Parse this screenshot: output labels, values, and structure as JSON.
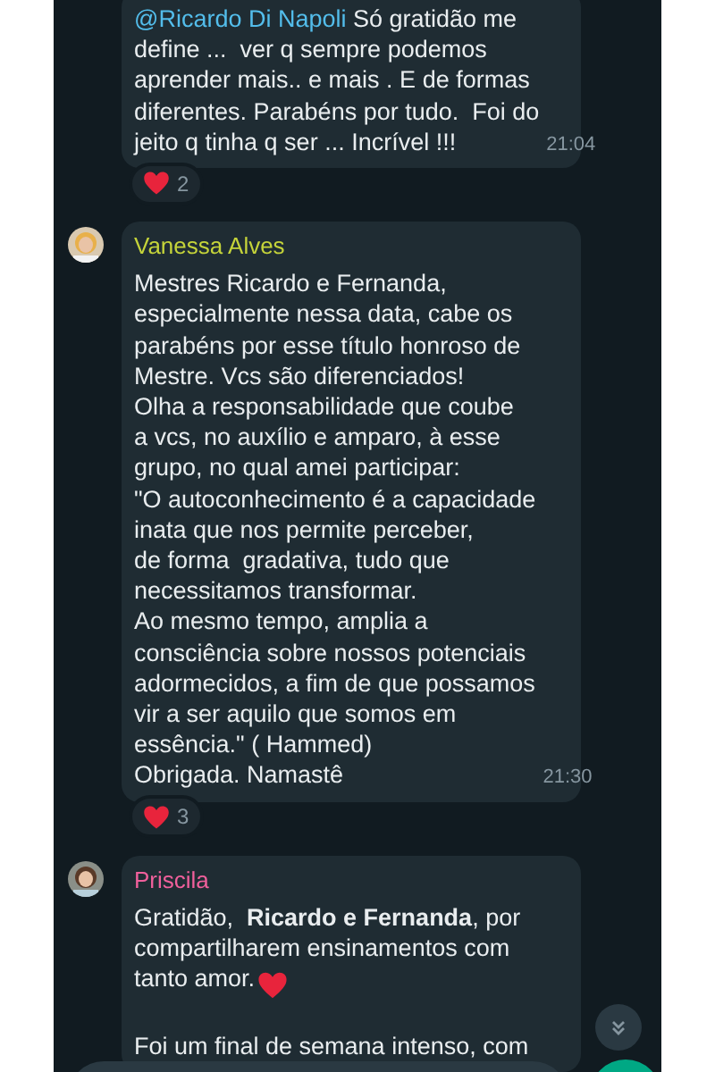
{
  "messages": [
    {
      "kind": "continued",
      "mention": "@Ricardo Di Napoli",
      "paragraphs": [
        {
          "text": "Só gratidão me\ndefine ...  ver q sempre podemos\naprender mais.. e mais . E de formas\ndiferentes. Parabéns por tudo.  Foi do\njeito q tinha q ser ... Incrível !!!",
          "heart": false
        }
      ],
      "time": "21:04",
      "reaction": {
        "count": "2"
      }
    },
    {
      "kind": "first",
      "avatar": {
        "kind": "picture"
      },
      "sender": "Vanessa Alves",
      "color": "#c5d43a",
      "paragraphs": [
        {
          "text": "Mestres Ricardo e Fernanda,\nespecialmente nessa data, cabe os\nparabéns por esse título honroso de\nMestre. Vcs são diferenciados!\nOlha a responsabilidade que coube\na vcs, no auxílio e amparo, à esse\ngrupo, no qual amei participar:\n\"O autoconhecimento é a capacidade\ninata que nos permite perceber,\nde forma  gradativa, tudo que\nnecessitamos transformar.\nAo mesmo tempo, amplia a\nconsciência sobre nossos potenciais\nadormecidos, a fim de que possamos\nvir a ser aquilo que somos em\nessência.\" ( Hammed)\nObrigada. Namastê",
          "heart": false
        }
      ],
      "time": "21:30",
      "reaction": {
        "count": "3"
      }
    },
    {
      "kind": "first",
      "avatar": {
        "kind": "picture"
      },
      "sender": "Priscila",
      "color": "#f0609c",
      "paragraphs": [
        {
          "text": "Gratidão,  **Ricardo e Fernanda**, por\ncompartilharem ensinamentos com\ntanto amor.",
          "heart": true
        },
        {
          "text": "Foi um final de semana intenso, com",
          "heart": false
        }
      ]
    }
  ]
}
